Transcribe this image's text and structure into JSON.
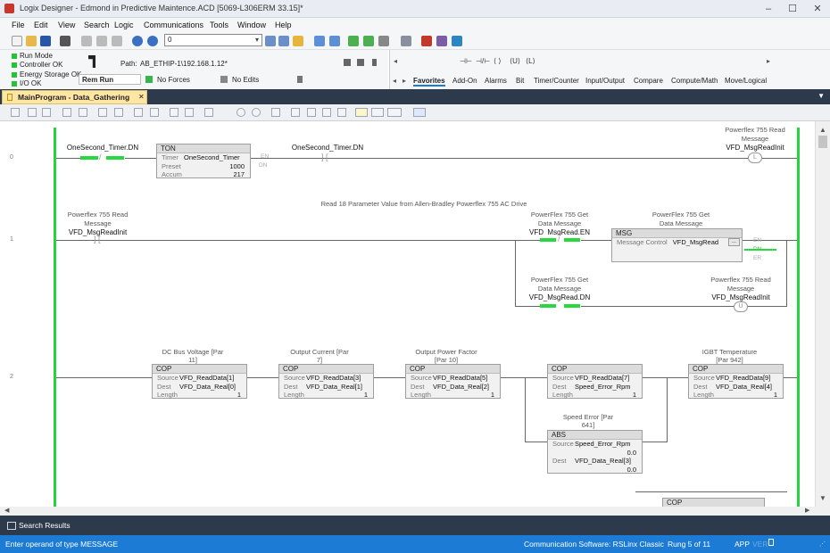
{
  "window": {
    "title": "Logix Designer - Edmond in Predictive Maintence.ACD [5069-L306ERM 33.15]*",
    "minimize": "–",
    "maximize": "☐",
    "close": "✕"
  },
  "menu": [
    "File",
    "Edit",
    "View",
    "Search",
    "Logic",
    "Communications",
    "Tools",
    "Window",
    "Help"
  ],
  "toolbar": {
    "combo_value": "0"
  },
  "status": {
    "run_mode": "Run Mode",
    "controller_ok": "Controller OK",
    "energy_storage_ok": "Energy Storage OK",
    "io_ok": "I/O OK",
    "path_label": "Path:",
    "path_value": "AB_ETHIP-1\\192.168.1.12*",
    "mode": "Rem Run",
    "forces": "No Forces",
    "edits": "No Edits"
  },
  "instruction_tabs": [
    "Favorites",
    "Add-On",
    "Alarms",
    "Bit",
    "Timer/Counter",
    "Input/Output",
    "Compare",
    "Compute/Math",
    "Move/Logical"
  ],
  "favorites_glyphs": [
    "⊣⊢",
    "⊣/⊢",
    "⟨ ⟩",
    "⟨U⟩",
    "⟨L⟩"
  ],
  "routine_tab": {
    "label": "MainProgram - Data_Gathering",
    "close": "✕"
  },
  "rungs": {
    "r0": {
      "number": "0",
      "xic_tag": "OneSecond_Timer.DN",
      "ton_title": "TON",
      "ton_timer_label": "Timer",
      "ton_timer_value": "OneSecond_Timer",
      "ton_preset_label": "Preset",
      "ton_preset_value": "1000",
      "ton_accum_label": "Accum",
      "ton_accum_value": "217",
      "ton_en": "EN",
      "ton_dn": "DN",
      "xio_tag": "OneSecond_Timer.DN",
      "coil_desc1": "Powerflex 755 Read",
      "coil_desc2": "Message",
      "coil_tag": "VFD_MsgReadInit",
      "coil_symbol": "L"
    },
    "r1": {
      "number": "1",
      "comment": "Read 18 Parameter Value from Allen-Bradley Powerflex 755 AC Drive",
      "xic_desc1": "Powerflex 755 Read",
      "xic_desc2": "Message",
      "xic_tag": "VFD_MsgReadInit",
      "en_desc1": "PowerFlex 755 Get",
      "en_desc2": "Data Message",
      "en_tag": "VFD_MsgRead.EN",
      "msg_desc1": "PowerFlex 755 Get",
      "msg_desc2": "Data Message",
      "msg_title": "MSG",
      "msg_ctrl_label": "Message Control",
      "msg_ctrl_value": "VFD_MsgRead",
      "msg_btn": "...",
      "msg_en": "EN",
      "msg_dn": "DN",
      "msg_er": "ER",
      "dn_desc1": "PowerFlex 755 Get",
      "dn_desc2": "Data Message",
      "dn_tag": "VFD_MsgRead.DN",
      "unl_desc1": "Powerflex 755 Read",
      "unl_desc2": "Message",
      "unl_tag": "VFD_MsgReadInit",
      "unl_symbol": "U"
    },
    "r2": {
      "number": "2",
      "source_label": "Source",
      "dest_label": "Dest",
      "length_label": "Length",
      "cop": [
        {
          "desc1": "DC Bus Voltage [Par",
          "desc2": "11]",
          "title": "COP",
          "source": "VFD_ReadData[1]",
          "dest": "VFD_Data_Real[0]",
          "length": "1"
        },
        {
          "desc1": "Output Current [Par",
          "desc2": "7]",
          "title": "COP",
          "source": "VFD_ReadData[3]",
          "dest": "VFD_Data_Real[1]",
          "length": "1"
        },
        {
          "desc1": "Output Power Factor",
          "desc2": "[Par 10]",
          "title": "COP",
          "source": "VFD_ReadData[5]",
          "dest": "VFD_Data_Real[2]",
          "length": "1"
        },
        {
          "desc1": "",
          "desc2": "",
          "title": "COP",
          "source": "VFD_ReadData[7]",
          "dest": "Speed_Error_Rpm",
          "length": "1"
        },
        {
          "desc1": "IGBT Temperature",
          "desc2": "[Par 942]",
          "title": "COP",
          "source": "VFD_ReadData[9]",
          "dest": "VFD_Data_Real[4]",
          "length": "1"
        }
      ],
      "abs_desc1": "Speed Error [Par",
      "abs_desc2": "641]",
      "abs_title": "ABS",
      "abs_source": "Speed_Error_Rpm",
      "abs_source_value": "0.0",
      "abs_dest": "VFD_Data_Real[3]",
      "abs_dest_value": "0.0",
      "next_title": "COP"
    }
  },
  "search_results": "Search Results",
  "statusbar": {
    "message": "Enter operand of type MESSAGE",
    "comm": "Communication Software: RSLinx Classic",
    "rung": "Rung 5 of 11",
    "app": "APP",
    "ver": "VER"
  },
  "colors": {
    "rail": "#25d43c",
    "status_blue": "#1c7bd4",
    "tab_active": "#ffe7a3",
    "dark_bar": "#2d3a4c"
  }
}
